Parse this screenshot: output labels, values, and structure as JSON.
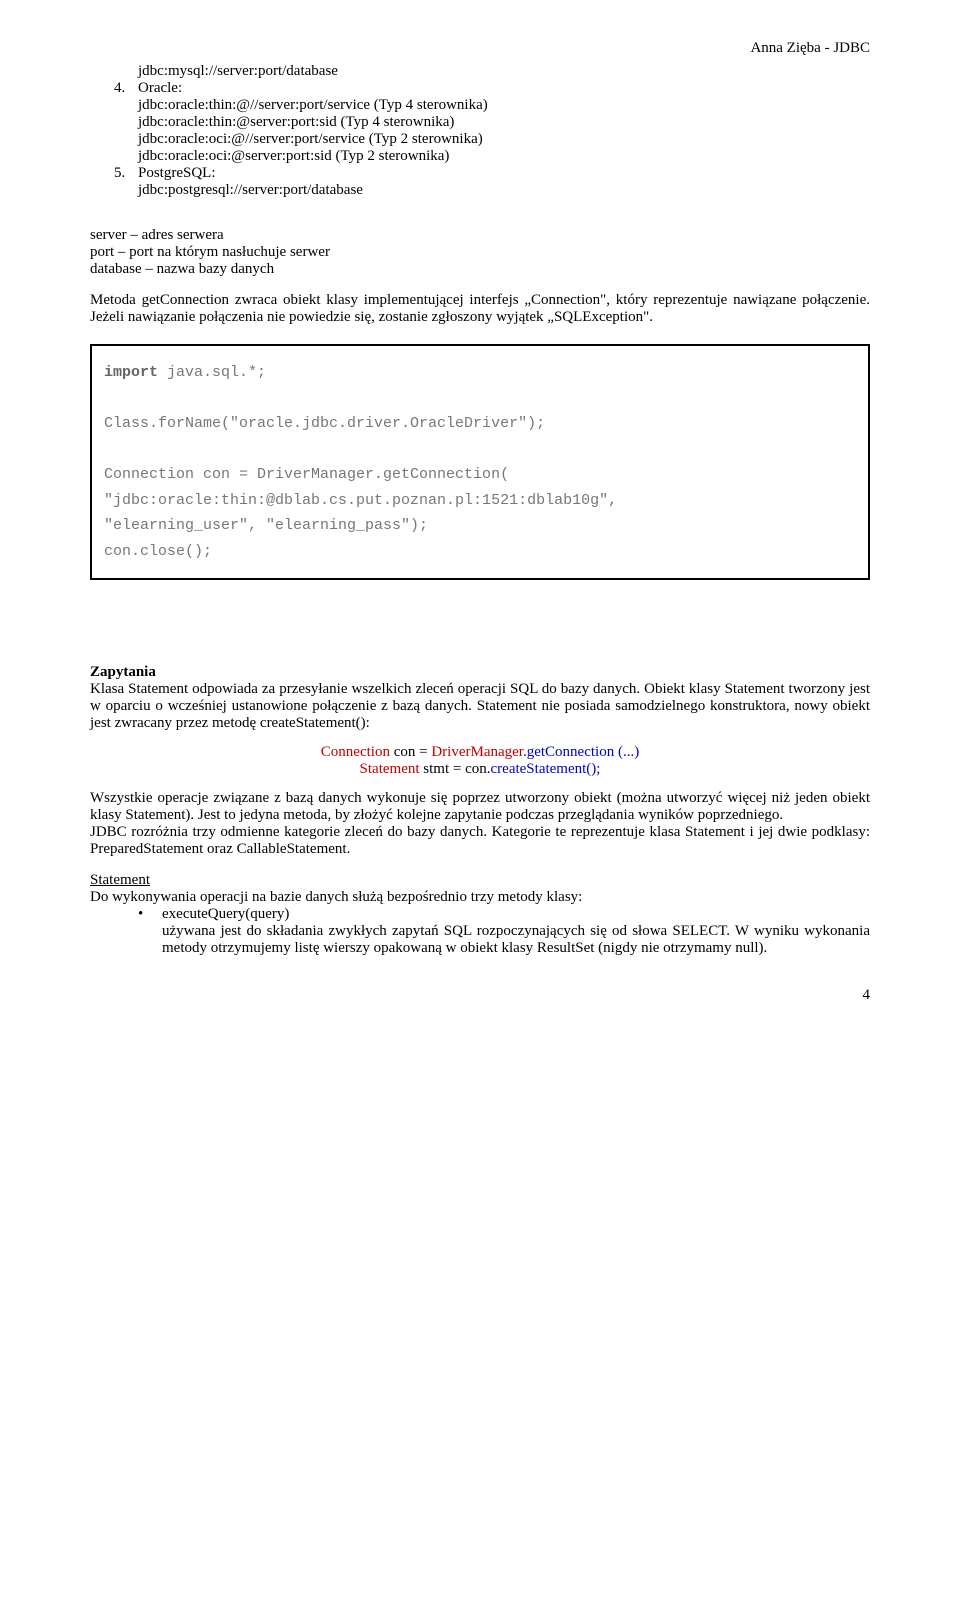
{
  "header": "Anna Zięba - JDBC",
  "url_mysql": "jdbc:mysql://server:port/database",
  "item4_num": "4.",
  "item4_label": "Oracle:",
  "oracle_line1": "jdbc:oracle:thin:@//server:port/service (Typ 4 sterownika)",
  "oracle_line2": "jdbc:oracle:thin:@server:port:sid (Typ 4 sterownika)",
  "oracle_line3": "jdbc:oracle:oci:@//server:port/service (Typ 2 sterownika)",
  "oracle_line4": "jdbc:oracle:oci:@server:port:sid (Typ 2 sterownika)",
  "item5_num": "5.",
  "item5_label": "PostgreSQL:",
  "pg_line": "jdbc:postgresql://server:port/database",
  "defs_line1": "server – adres serwera",
  "defs_line2": "port – port na którym nasłuchuje serwer",
  "defs_line3": "database – nazwa bazy danych",
  "para1": "Metoda getConnection  zwraca obiekt klasy implementującej interfejs „Connection\", który reprezentuje nawiązane połączenie. Jeżeli nawiązanie połączenia nie powiedzie się, zostanie zgłoszony wyjątek „SQLException\".",
  "code": {
    "l1a": "import",
    "l1b": " java.sql.*;",
    "l2": "Class.forName(\"oracle.jdbc.driver.OracleDriver\");",
    "l3": "Connection con = DriverManager.getConnection(",
    "l4": "\"jdbc:oracle:thin:@dblab.cs.put.poznan.pl:1521:dblab10g\",",
    "l5": "\"elearning_user\", \"elearning_pass\");",
    "l6": "con.close();"
  },
  "zapytania_title": "Zapytania",
  "zapytania_para": "Klasa Statement odpowiada za przesyłanie wszelkich zleceń operacji SQL do bazy danych. Obiekt klasy Statement tworzony jest w oparciu o wcześniej ustanowione połączenie z bazą danych. Statement nie posiada samodzielnego konstruktora, nowy obiekt jest zwracany przez metodę createStatement():",
  "center_line1_a": "Connection",
  "center_line1_b": " con = ",
  "center_line1_c": "DriverManager",
  "center_line1_d": ".getConnection (...)",
  "center_line2_a": "Statement",
  "center_line2_b": " stmt = con.",
  "center_line2_c": "createStatement();",
  "para2": "Wszystkie operacje związane z bazą danych wykonuje się poprzez utworzony obiekt (można utworzyć więcej niż jeden obiekt klasy Statement). Jest to jedyna metoda, by złożyć kolejne zapytanie podczas przeglądania wyników poprzedniego.",
  "para3": "JDBC rozróżnia trzy odmienne kategorie zleceń do bazy danych. Kategorie te reprezentuje klasa Statement i jej dwie podklasy: PreparedStatement oraz CallableStatement.",
  "statement_u": "Statement",
  "statement_line": "Do wykonywania operacji na bazie danych służą bezpośrednio trzy metody klasy:",
  "bullet_dot": "•",
  "bullet_title": "executeQuery(query)",
  "bullet_body": "używana jest do składania zwykłych zapytań SQL rozpoczynających się od słowa SELECT. W wyniku wykonania metody otrzymujemy listę wierszy opakowaną w obiekt klasy ResultSet (nigdy nie otrzymamy null).",
  "page_num": "4"
}
